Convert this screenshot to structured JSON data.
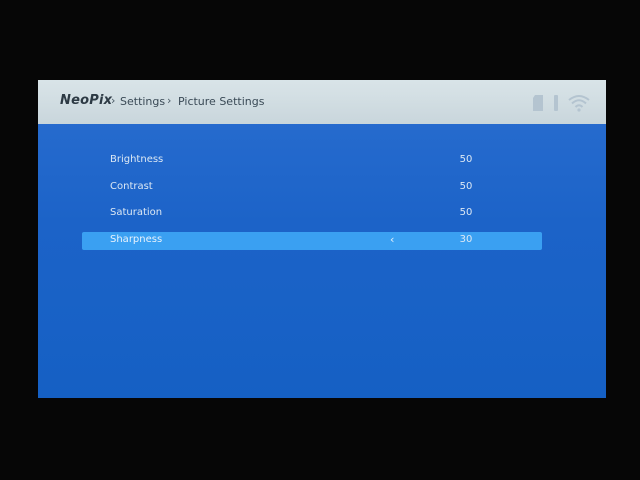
{
  "header": {
    "brand": "NeoPix",
    "separator": "›",
    "breadcrumbs": [
      "Settings",
      "Picture Settings"
    ],
    "icons": [
      "sd-card-icon",
      "usb-icon",
      "wifi-icon"
    ]
  },
  "settings": {
    "items": [
      {
        "label": "Brightness",
        "value": "50",
        "selected": false
      },
      {
        "label": "Contrast",
        "value": "50",
        "selected": false
      },
      {
        "label": "Saturation",
        "value": "50",
        "selected": false
      },
      {
        "label": "Sharpness",
        "value": "30",
        "selected": true
      }
    ],
    "selected_prev_glyph": "‹"
  },
  "colors": {
    "screen_blue": "#1c63c8",
    "header_gray": "#d0dbe0",
    "selected_row": "#3aa0f2"
  }
}
